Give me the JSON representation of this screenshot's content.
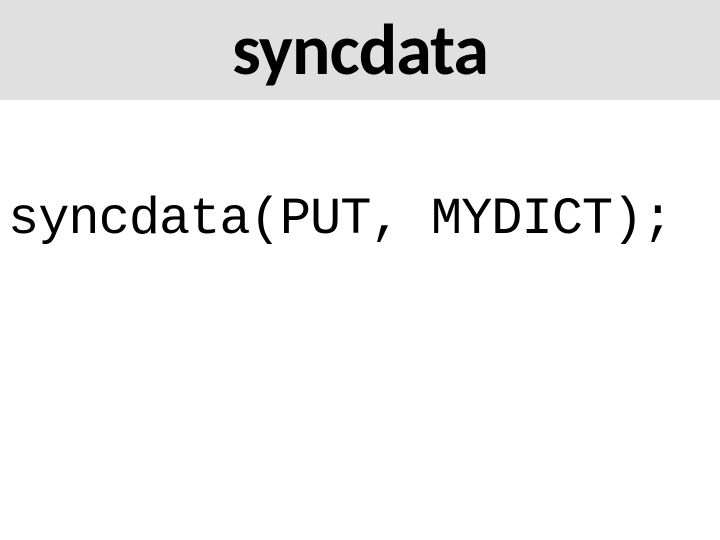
{
  "header": {
    "title": "syncdata"
  },
  "body": {
    "code": "syncdata(PUT, MYDICT);"
  }
}
